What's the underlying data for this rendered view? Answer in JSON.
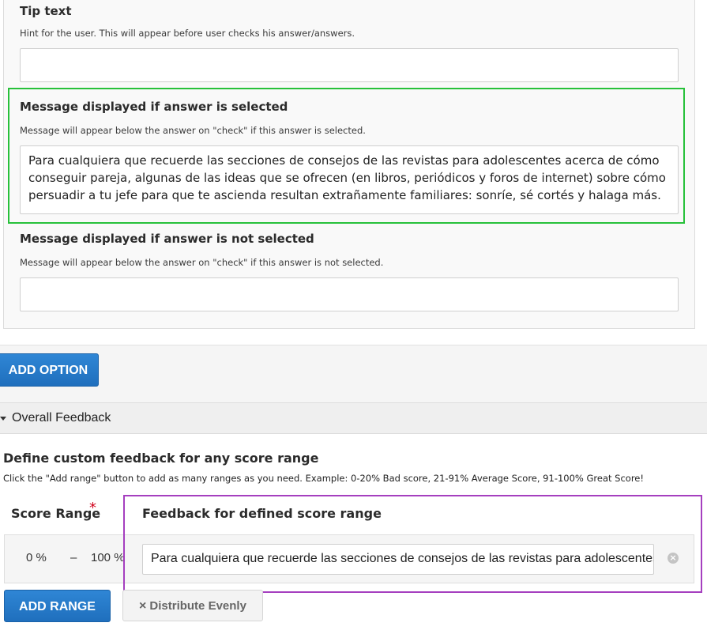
{
  "tip": {
    "label": "Tip text",
    "hint": "Hint for the user. This will appear before user checks his answer/answers.",
    "value": ""
  },
  "selected_msg": {
    "label": "Message displayed if answer is selected",
    "hint": "Message will appear below the answer on \"check\" if this answer is selected.",
    "value": "Para cualquiera que recuerde las secciones de consejos de las revistas para adolescentes acerca de cómo conseguir pareja, algunas de las ideas que se ofrecen (en libros, periódicos y foros de internet) sobre cómo persuadir a tu jefe para que te ascienda resultan extrañamente familiares: sonríe, sé cortés y halaga más."
  },
  "not_selected_msg": {
    "label": "Message displayed if answer is not selected",
    "hint": "Message will appear below the answer on \"check\" if this answer is not selected.",
    "value": ""
  },
  "add_option_label": "ADD OPTION",
  "overall_feedback": {
    "section_title": "Overall Feedback",
    "heading": "Define custom feedback for any score range",
    "description": "Click the \"Add range\" button to add as many ranges as you need. Example: 0-20% Bad score, 21-91% Average Score, 91-100% Great Score!",
    "score_range_header": "Score Range",
    "required_mark": "*",
    "feedback_header": "Feedback for defined score range",
    "ranges": [
      {
        "from": "0 %",
        "separator": "–",
        "to": "100 %",
        "feedback": "Para cualquiera que recuerde las secciones de consejos de las revistas para adolescentes acerca de cómo conseguir pareja, algunas de las ideas"
      }
    ],
    "add_range_label": "ADD RANGE",
    "distribute_label": "Distribute Evenly",
    "distribute_icon": "×",
    "remove_icon": "×"
  },
  "colors": {
    "highlight_green": "#27c13a",
    "highlight_purple": "#a53fbf",
    "button_blue": "#2377c8"
  }
}
